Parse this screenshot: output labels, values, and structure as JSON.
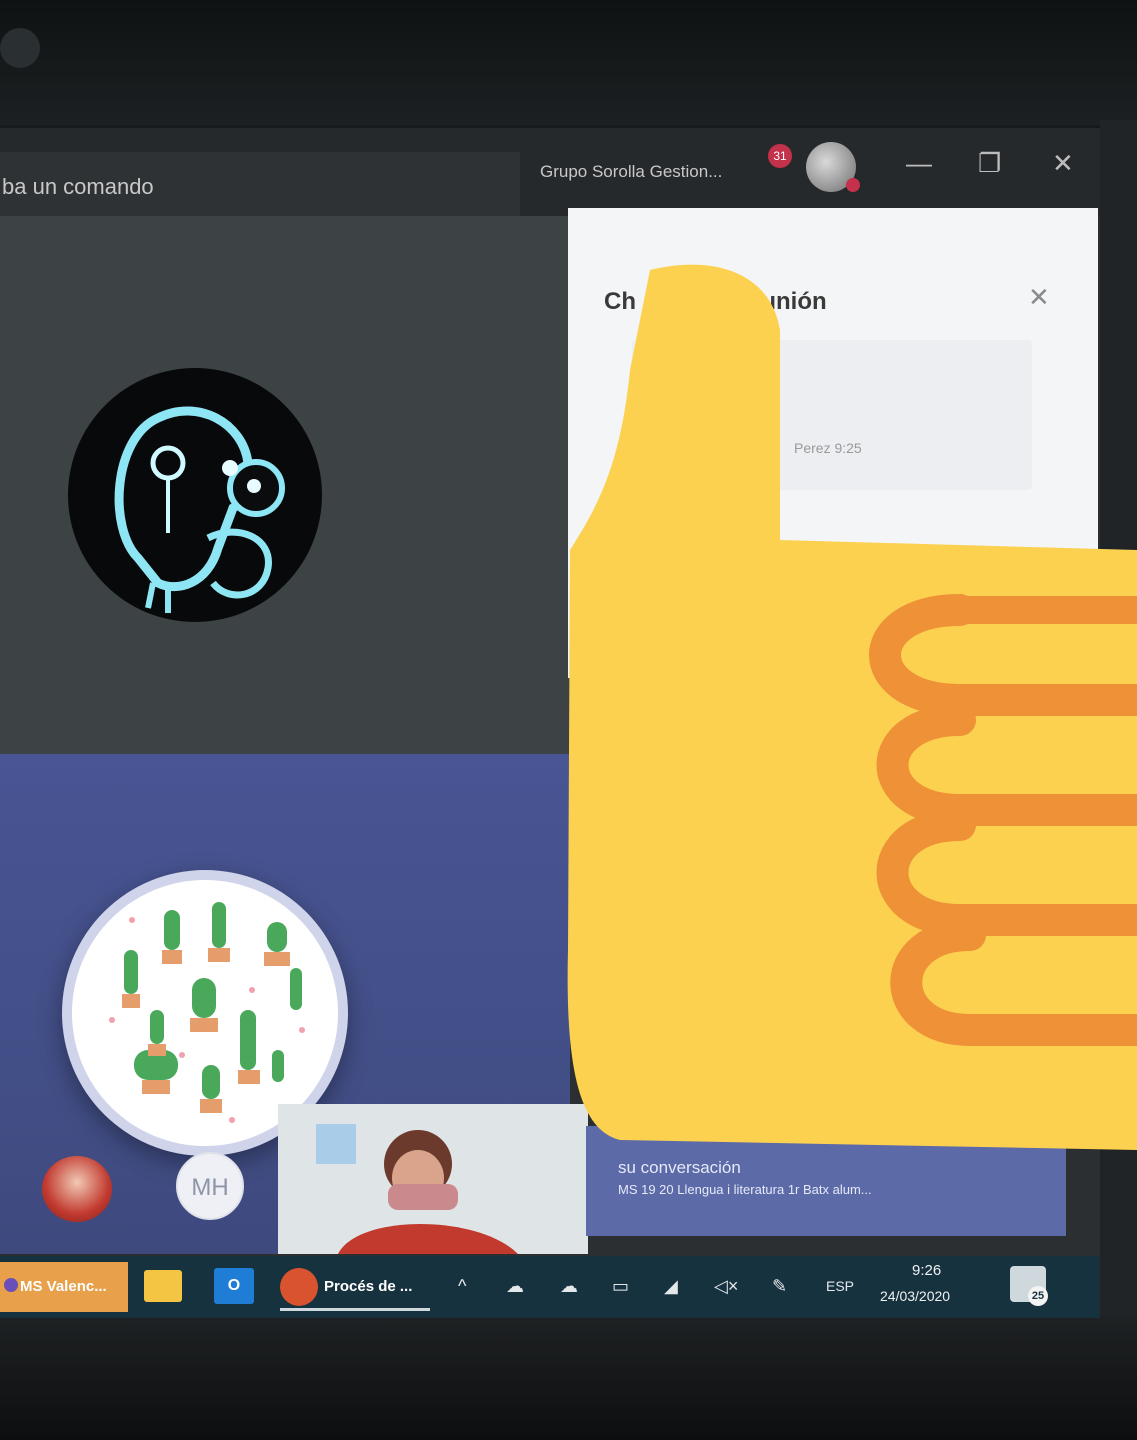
{
  "window": {
    "command_box": {
      "text": "ba un comando"
    },
    "org_name": "Grupo Sorolla Gestion...",
    "notification_count": "31",
    "minimize_label": "—",
    "restore_label": "❐",
    "close_label": "✕"
  },
  "participants": [
    {
      "kind": "avatar-image",
      "icon": "xray-skull-icon"
    },
    {
      "kind": "avatar-image",
      "icon": "cactus-pattern-icon"
    },
    {
      "kind": "avatar-image",
      "icon": "person-photo-icon"
    },
    {
      "kind": "initials",
      "initials": "MH"
    }
  ],
  "chat": {
    "title_left": "Ch",
    "title_right": "unión",
    "close_label": "✕",
    "meta": "Perez  9:25"
  },
  "toast": {
    "line1": "su conversación",
    "line2": "MS 19 20 Llengua i literatura 1r Batx alum..."
  },
  "taskbar": {
    "apps": [
      {
        "label": "MS Valenc...",
        "active": true
      },
      {
        "label": "",
        "icon": "file-explorer-icon"
      },
      {
        "label": "",
        "icon": "outlook-icon"
      },
      {
        "label": "Procés de ...",
        "icon": "powerpoint-icon"
      }
    ],
    "tray_icons": [
      "chevron-up-icon",
      "onedrive-icon",
      "onedrive-icon",
      "keyboard-icon",
      "network-icon",
      "volume-muted-icon",
      "pen-icon"
    ],
    "language": "ESP",
    "time": "9:26",
    "date": "24/03/2020",
    "notifications": "25"
  },
  "colors": {
    "toast_bg": "#5c6aa8",
    "taskbar_bg": "#16323f",
    "notification_badge": "#c4314b",
    "thumb_fill": "#fdd150",
    "thumb_stroke": "#ee9137"
  }
}
